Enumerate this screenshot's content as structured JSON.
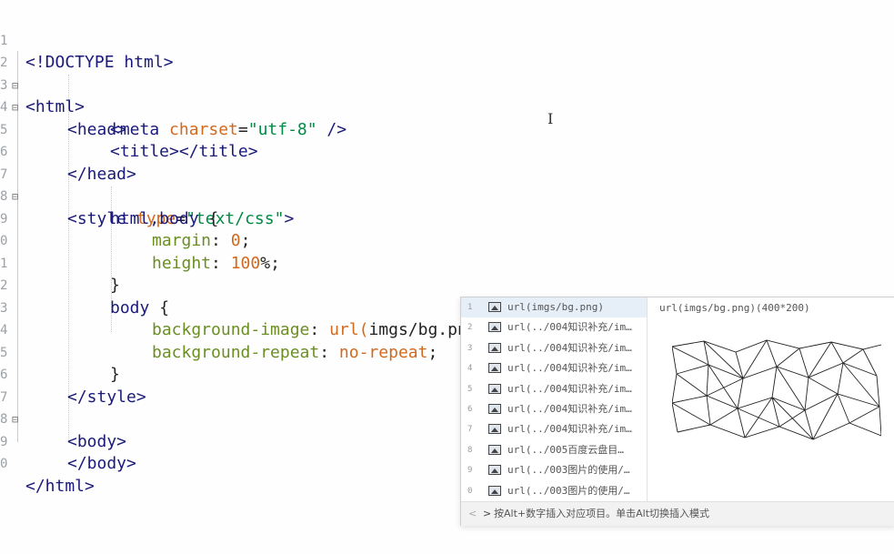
{
  "editor": {
    "line_numbers": [
      "1",
      "2",
      "3",
      "4",
      "5",
      "6",
      "7",
      "8",
      "9",
      "0",
      "1",
      "2",
      "3",
      "4",
      "5",
      "6",
      "7",
      "8",
      "9",
      "0"
    ],
    "lines": [
      [
        "<!DOCTYPE html>"
      ],
      [
        "<html>"
      ],
      [
        "<head>"
      ],
      [
        "<meta",
        " charset",
        "=",
        "\"utf-8\"",
        " />"
      ],
      [
        "<title></title>"
      ],
      [
        "</head>"
      ],
      [
        "<style",
        " type",
        "=",
        "\"text/css\"",
        ">"
      ],
      [
        "html,body",
        " {"
      ],
      [
        "margin",
        ": ",
        "0",
        ";"
      ],
      [
        "height",
        ": ",
        "100",
        "%;"
      ],
      [
        "}"
      ],
      [
        "body",
        " {"
      ],
      [
        "background-image",
        ": ",
        "url(",
        "imgs/bg.png",
        ")",
        ";"
      ],
      [
        "background-repeat",
        ": ",
        "no-repeat",
        ";"
      ],
      [
        "}"
      ],
      [
        "</style>"
      ],
      [
        "<body>"
      ],
      [
        ""
      ],
      [
        "</body>"
      ],
      [
        "</html>"
      ]
    ],
    "fold_marker": "⊟"
  },
  "autocomplete": {
    "items": [
      {
        "index": "1",
        "text": "url(imgs/bg.png)"
      },
      {
        "index": "2",
        "text": "url(../004知识补充/im…"
      },
      {
        "index": "3",
        "text": "url(../004知识补充/im…"
      },
      {
        "index": "4",
        "text": "url(../004知识补充/im…"
      },
      {
        "index": "5",
        "text": "url(../004知识补充/im…"
      },
      {
        "index": "6",
        "text": "url(../004知识补充/im…"
      },
      {
        "index": "7",
        "text": "url(../004知识补充/im…"
      },
      {
        "index": "8",
        "text": "url(../005百度云盘目…"
      },
      {
        "index": "9",
        "text": "url(../003图片的使用/…"
      },
      {
        "index": "0",
        "text": "url(../003图片的使用/…"
      }
    ],
    "preview_title": "url(imgs/bg.png)(400*200)",
    "footer": {
      "prev": "<",
      "next": ">",
      "hint": "按Alt+数字插入对应项目。单击Alt切换插入模式"
    }
  },
  "colors": {
    "tag": "#1a1a7a",
    "attribute": "#d2691e",
    "string": "#008b45",
    "property": "#6b8e23",
    "selected_item": "#e6eef8"
  }
}
